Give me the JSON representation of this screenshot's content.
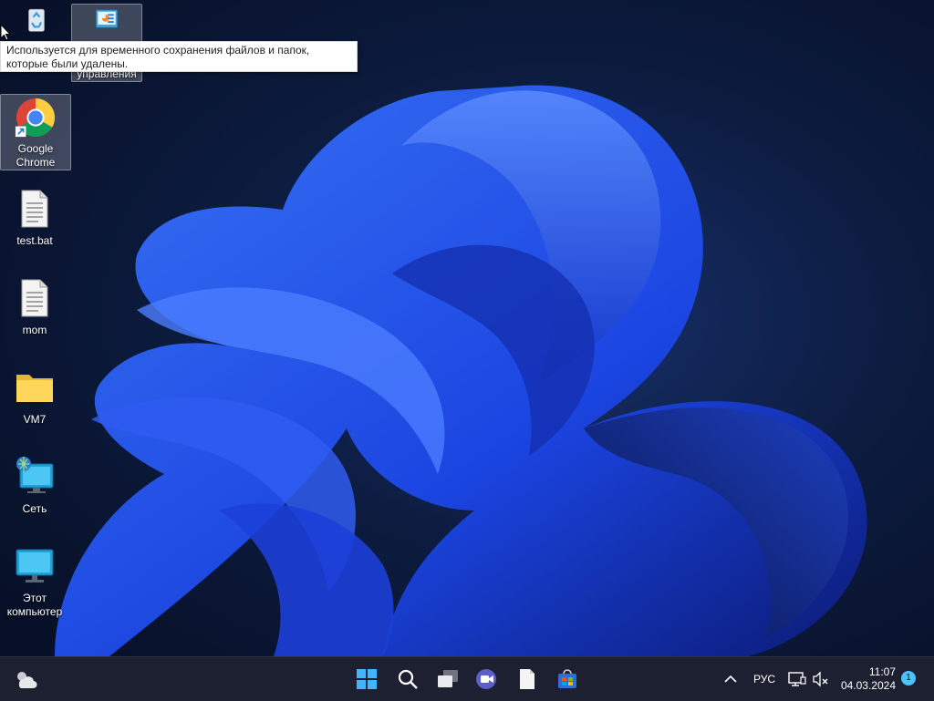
{
  "desktop": {
    "icons": [
      {
        "label": ""
      },
      {
        "label": "управления"
      },
      {
        "label": "Google Chrome"
      },
      {
        "label": "test.bat"
      },
      {
        "label": "mom"
      },
      {
        "label": "VM7"
      },
      {
        "label": "Сеть"
      },
      {
        "label": "Этот компьютер"
      }
    ],
    "tooltip": "Используется для временного сохранения файлов и папок, которые были удалены."
  },
  "taskbar": {
    "widgets_icon": "weather-icon",
    "pinned": [
      {
        "name": "start-button",
        "icon": "windows-logo-icon"
      },
      {
        "name": "search-button",
        "icon": "search-icon"
      },
      {
        "name": "task-view-button",
        "icon": "task-view-icon"
      },
      {
        "name": "teams-button",
        "icon": "video-chat-icon"
      },
      {
        "name": "notepad-button",
        "icon": "document-icon"
      },
      {
        "name": "store-button",
        "icon": "store-icon"
      }
    ],
    "tray": {
      "language": "РУС",
      "time": "11:07",
      "date": "04.03.2024",
      "notifications": "1"
    }
  },
  "colors": {
    "accent": "#4cc2ff",
    "taskbar": "#1c2030",
    "wallpaper_bloom": "#1a47e6"
  }
}
